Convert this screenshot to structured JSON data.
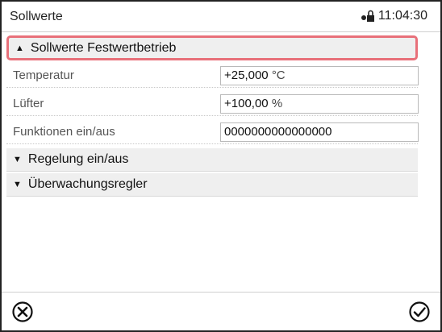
{
  "header": {
    "title": "Sollwerte",
    "time": "11:04:30",
    "status_icon": "lock-icon"
  },
  "sections": {
    "festwert": {
      "label": "Sollwerte Festwertbetrieb",
      "state": "expanded"
    },
    "regelung": {
      "label": "Regelung ein/aus",
      "state": "collapsed"
    },
    "ueberwachung": {
      "label": "Überwachungsregler",
      "state": "collapsed"
    }
  },
  "rows": [
    {
      "label": "Temperatur",
      "value": "+25,000",
      "unit": "°C"
    },
    {
      "label": "Lüfter",
      "value": "+100,00",
      "unit": "%"
    },
    {
      "label": "Funktionen ein/aus",
      "value": "0000000000000000",
      "unit": ""
    }
  ],
  "footer": {
    "cancel_icon": "cancel-circle-x-icon",
    "confirm_icon": "confirm-checkmark-icon"
  },
  "colors": {
    "highlight": "#e8707a",
    "section_bg": "#efefef"
  }
}
